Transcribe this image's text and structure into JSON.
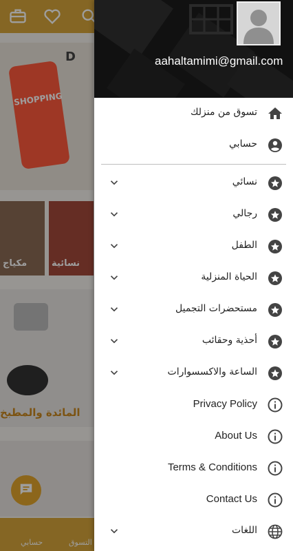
{
  "background": {
    "banner_label": "D",
    "banner_shopping": "SHOPPING",
    "tiles": [
      "مكياج",
      "نسائية"
    ],
    "kitchen_label": "المائدة والمطبخ",
    "bottom_nav": [
      "حسابي",
      "التسوق"
    ]
  },
  "account": {
    "email": "aahaltamimi@gmail.com"
  },
  "menu": {
    "top_items": [
      {
        "label": "تسوق من منزلك",
        "icon": "home-icon"
      },
      {
        "label": "حسابي",
        "icon": "account-circle-icon"
      }
    ],
    "categories": [
      {
        "label": "نسائي",
        "icon": "star-icon"
      },
      {
        "label": "رجالي",
        "icon": "star-icon"
      },
      {
        "label": "الطفل",
        "icon": "star-icon"
      },
      {
        "label": "الحياة المنزلية",
        "icon": "star-icon"
      },
      {
        "label": "مستحضرات التجميل",
        "icon": "star-icon"
      },
      {
        "label": "أحذية وحقائب",
        "icon": "star-icon"
      },
      {
        "label": "الساعة والاكسسوارات",
        "icon": "star-icon"
      }
    ],
    "info_items": [
      {
        "label": "Privacy Policy",
        "icon": "info-icon"
      },
      {
        "label": "About Us",
        "icon": "info-icon"
      },
      {
        "label": "Terms & Conditions",
        "icon": "info-icon"
      },
      {
        "label": "Contact Us",
        "icon": "info-icon"
      }
    ],
    "language_item": {
      "label": "اللغات",
      "icon": "globe-icon"
    }
  },
  "colors": {
    "accent": "#d7a53a",
    "icon": "#444444",
    "header_bg": "#111111"
  }
}
